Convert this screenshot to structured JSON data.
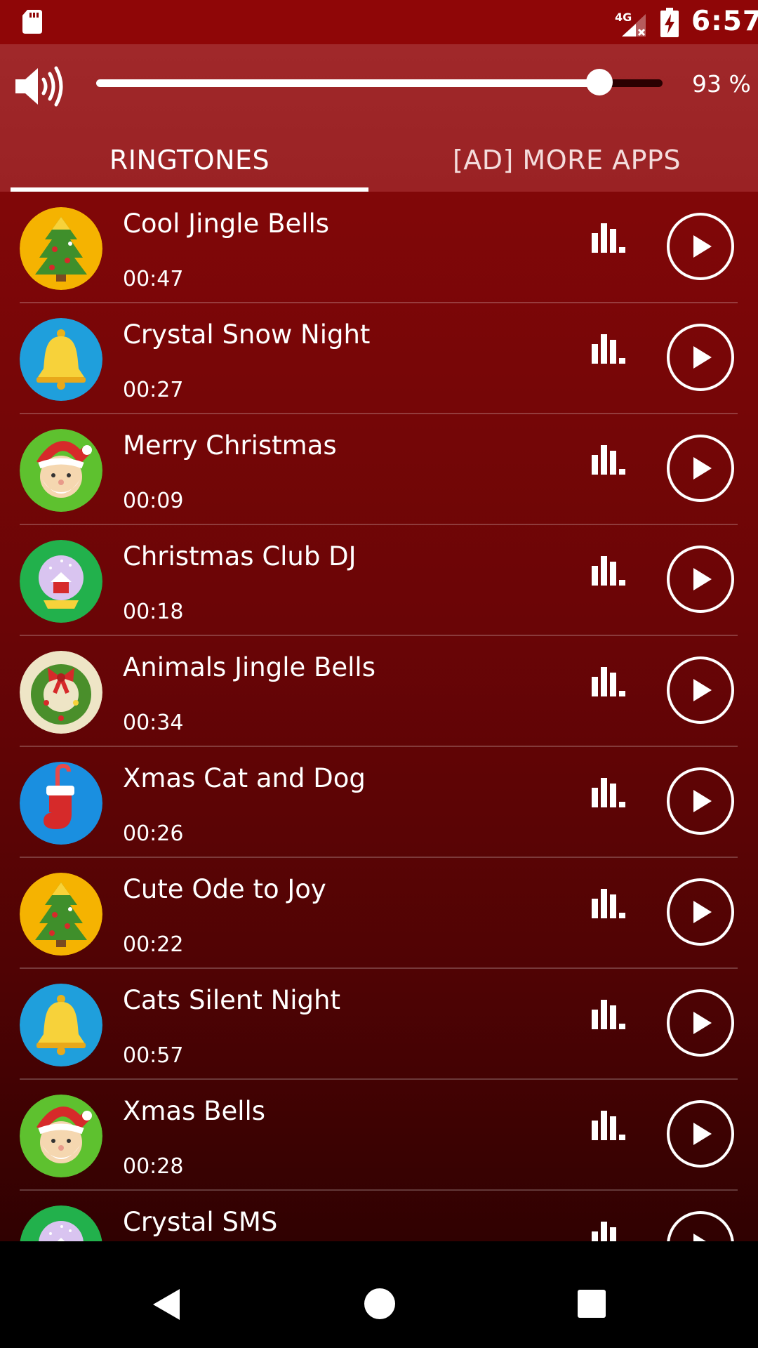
{
  "status_bar": {
    "network_label": "4G",
    "time": "6:57"
  },
  "volume": {
    "percent_label": "93 %",
    "level": 0.93
  },
  "tabs": [
    {
      "label": "RINGTONES",
      "selected": true
    },
    {
      "label": "[AD] MORE APPS",
      "selected": false
    }
  ],
  "ringtones": [
    {
      "title": "Cool Jingle Bells",
      "duration": "00:47",
      "icon": "christmas-tree-icon",
      "icon_bg": "#f5b301"
    },
    {
      "title": "Crystal Snow Night",
      "duration": "00:27",
      "icon": "bell-icon",
      "icon_bg": "#1f9fdc"
    },
    {
      "title": "Merry Christmas",
      "duration": "00:09",
      "icon": "santa-icon",
      "icon_bg": "#5ec12f"
    },
    {
      "title": "Christmas Club DJ",
      "duration": "00:18",
      "icon": "snow-globe-icon",
      "icon_bg": "#22b14c"
    },
    {
      "title": "Animals Jingle Bells",
      "duration": "00:34",
      "icon": "wreath-icon",
      "icon_bg": "#eee5c6"
    },
    {
      "title": "Xmas Cat and Dog",
      "duration": "00:26",
      "icon": "stocking-icon",
      "icon_bg": "#1a8fe0"
    },
    {
      "title": "Cute Ode to Joy",
      "duration": "00:22",
      "icon": "christmas-tree-icon",
      "icon_bg": "#f5b301"
    },
    {
      "title": "Cats Silent Night",
      "duration": "00:57",
      "icon": "bell-icon",
      "icon_bg": "#1f9fdc"
    },
    {
      "title": "Xmas Bells",
      "duration": "00:28",
      "icon": "santa-icon",
      "icon_bg": "#5ec12f"
    },
    {
      "title": "Crystal SMS",
      "duration": "",
      "icon": "snow-globe-icon",
      "icon_bg": "#22b14c"
    }
  ],
  "colors": {
    "status_bar": "#8f0607",
    "header": "#9f2729",
    "list_top": "#810708",
    "list_bottom": "#300101",
    "nav_bar": "#000000"
  }
}
